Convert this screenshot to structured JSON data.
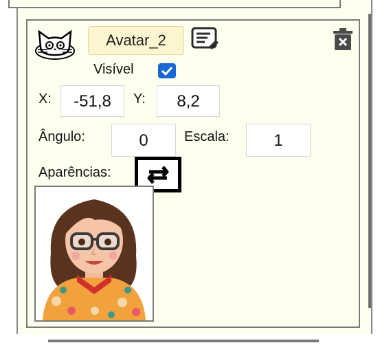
{
  "sprite": {
    "name": "Avatar_2",
    "visible_label": "Visível",
    "visible_checked": true
  },
  "position": {
    "x_label": "X:",
    "x_value": "-51,8",
    "y_label": "Y:",
    "y_value": "8,2"
  },
  "transform": {
    "angle_label": "Ângulo:",
    "angle_value": "0",
    "scale_label": "Escala:",
    "scale_value": "1"
  },
  "costumes": {
    "label": "Aparências:"
  },
  "icons": {
    "cat": "cat-icon",
    "edit": "edit-note-icon",
    "delete": "trash-icon",
    "swap": "swap-arrows-icon",
    "check": "check-icon"
  },
  "colors": {
    "panel_bg": "#fffff0",
    "name_bg": "#fdf5cf",
    "checkbox": "#1967d2",
    "swap_border": "#000000"
  }
}
